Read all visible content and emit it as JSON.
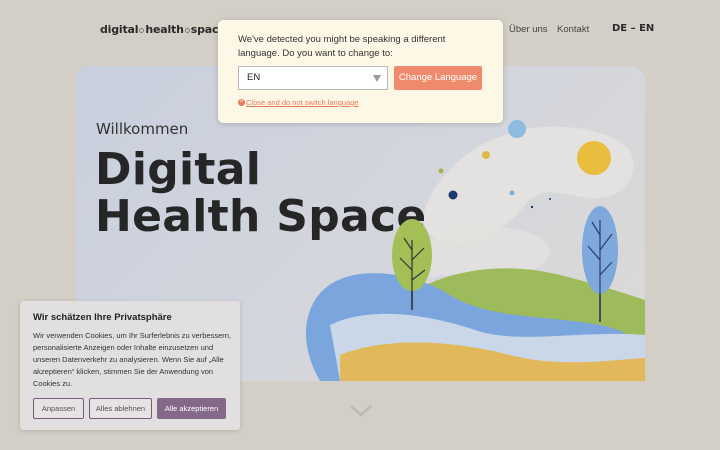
{
  "header": {
    "logo_parts": [
      "digital",
      "health",
      "space"
    ],
    "nav": {
      "about": "Über uns",
      "contact": "Kontakt"
    },
    "language_switch": "DE – EN"
  },
  "hero": {
    "welcome": "Willkommen",
    "title": "Digital Health Space"
  },
  "language_modal": {
    "message": "We've detected you might be speaking a different language. Do you want to change to:",
    "selected_language": "EN",
    "change_button": "Change Language",
    "close_link": "Close and do not switch language"
  },
  "cookie_banner": {
    "title": "Wir schätzen Ihre Privatsphäre",
    "text": "Wir verwenden Cookies, um Ihr Surferlebnis zu verbessern, personalisierte Anzeigen oder Inhalte einzusetzen und unseren Datenverkehr zu analysieren. Wenn Sie auf „Alle akzeptieren“ klicken, stimmen Sie der Anwendung von Cookies zu.",
    "buttons": {
      "adjust": "Anpassen",
      "reject": "Alles ablehnen",
      "accept": "Alle akzeptieren"
    }
  },
  "colors": {
    "background": "#d3cfc7",
    "accent": "#f08a6c",
    "cookie_accept": "#85698a",
    "modal_bg": "#fdf7e6"
  },
  "icons": {
    "scroll_down": "chevron-down-icon",
    "dropdown": "caret-down-icon",
    "close": "close-circle-icon"
  }
}
